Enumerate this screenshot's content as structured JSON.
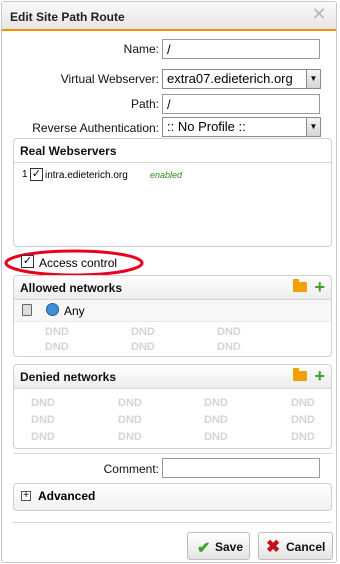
{
  "dialog": {
    "title": "Edit Site Path Route",
    "close_glyph": "✕"
  },
  "form": {
    "name_label": "Name:",
    "name_value": "/",
    "vws_label": "Virtual Webserver:",
    "vws_value": "extra07.edieterich.org",
    "path_label": "Path:",
    "path_value": "/",
    "reverse_auth_label": "Reverse Authentication:",
    "reverse_auth_value": ":: No Profile ::"
  },
  "real_webservers": {
    "title": "Real Webservers",
    "items": [
      {
        "index": "1",
        "host": "intra.edieterich.org",
        "status": "enabled"
      }
    ]
  },
  "access_control": {
    "label": "Access control",
    "checked": true
  },
  "allowed_networks": {
    "title": "Allowed networks",
    "items": [
      {
        "label": "Any"
      }
    ],
    "dnd": "DND"
  },
  "denied_networks": {
    "title": "Denied networks",
    "dnd": "DND"
  },
  "comment": {
    "label": "Comment:",
    "value": ""
  },
  "advanced": {
    "label": "Advanced",
    "toggle": "+"
  },
  "buttons": {
    "save": "Save",
    "cancel": "Cancel"
  },
  "colors": {
    "accent": "#f29400",
    "enabled": "#2e8b1e",
    "annotation": "#e8001c",
    "save_icon": "#3aa52a",
    "cancel_icon": "#c0111f"
  }
}
